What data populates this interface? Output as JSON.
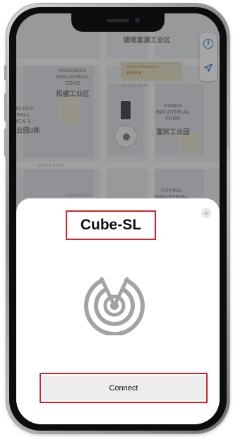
{
  "map": {
    "labels": {
      "top_zh": "塘尾富源工业区",
      "hesheng_en": "HESHENG\nINDUSTRIAL\nZONE",
      "hesheng_zh": "和盛工业区",
      "fumin_en": "FUMIN\nINDUSTRIAL\nPARK",
      "fumin_zh": "富民工业园",
      "angyao_en": "NGYAO\nTRIAL\nOCK 3",
      "angyao_zh": "业园3栋",
      "fuying_en": "FUYING",
      "fuying_en2": "INDUSTRIAL"
    },
    "store_tag": "Tongwei Emporium\n通威商场",
    "road_labels": [
      "BAOHE ROAD",
      "SHAHE ROAD",
      "FUMIN ROAD"
    ]
  },
  "dialog": {
    "title": "Cube-SL",
    "close_glyph": "×",
    "connect_label": "Connect"
  },
  "colors": {
    "highlight": "#d4212b",
    "map_accent": "#2f7de1"
  }
}
